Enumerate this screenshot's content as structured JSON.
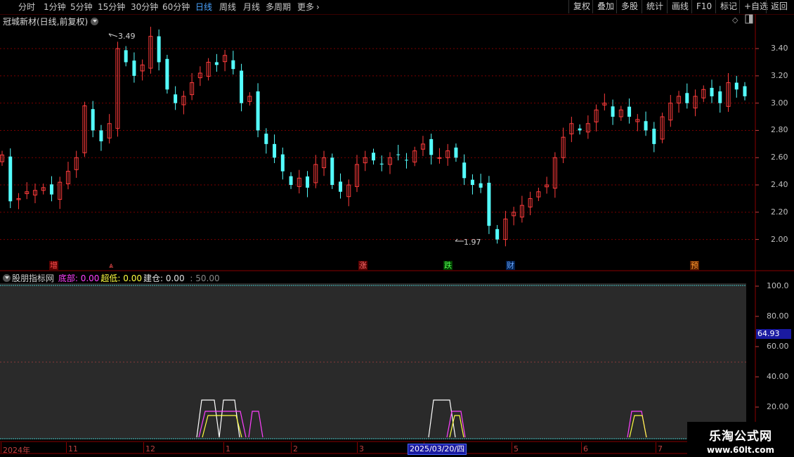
{
  "toolbar": {
    "periods": [
      "分时",
      "1分钟",
      "5分钟",
      "15分钟",
      "30分钟",
      "60分钟",
      "日线",
      "周线",
      "月线",
      "多周期",
      "更多"
    ],
    "active": "日线",
    "right_buttons": [
      "复权",
      "叠加",
      "多股",
      "统计",
      "画线",
      "F10",
      "标记",
      "+自选",
      "返回"
    ]
  },
  "stock": {
    "title": "冠城新材(日线,前复权)"
  },
  "main_axis": {
    "labels": [
      "3.40",
      "3.20",
      "3.00",
      "2.80",
      "2.60",
      "2.40",
      "2.20",
      "2.00"
    ]
  },
  "annotations": {
    "high": "3.49",
    "low": "1.97"
  },
  "events": [
    {
      "label": "增",
      "color": "#ff5050",
      "bg": "#5a0000"
    },
    {
      "label": "⩓",
      "color": "#ff5050",
      "bg": ""
    },
    {
      "label": "涨",
      "color": "#ff7070",
      "bg": "#5a0000"
    },
    {
      "label": "跌",
      "color": "#50ff50",
      "bg": "#004000"
    },
    {
      "label": "财",
      "color": "#6aa8ff",
      "bg": "#002050"
    },
    {
      "label": "预",
      "color": "#ff9a30",
      "bg": "#5a2000"
    }
  ],
  "indicator": {
    "name": "股朋指标网",
    "fields": [
      {
        "label": "底部:",
        "value": "0.00",
        "color": "#ff40ff"
      },
      {
        "label": "超低:",
        "value": "0.00",
        "color": "#ffff40"
      },
      {
        "label": "建仓:",
        "value": "0.00",
        "color": "#e0e0e0"
      }
    ],
    "extra": ": 50.00",
    "axis": [
      "100.0",
      "80.00",
      "60.00",
      "40.00",
      "20.00"
    ],
    "cursor_value": "64.93"
  },
  "xaxis": {
    "labels": [
      "2024年",
      "11",
      "12",
      "1",
      "2",
      "3",
      "4",
      "5",
      "6",
      "7"
    ],
    "cursor_date": "2025/03/20/四"
  },
  "watermark": {
    "line1": "乐淘公式网",
    "line2": "www.60lt.com"
  },
  "colors": {
    "up": "#ff3c3c",
    "down": "#54ffff",
    "grid": "#7a0000",
    "ind_bg": "#2a2a2a"
  },
  "chart_data": {
    "type": "candlestick",
    "ylim": [
      1.9,
      3.55
    ],
    "closes": [
      2.62,
      2.28,
      2.3,
      2.35,
      2.36,
      2.38,
      2.33,
      2.42,
      2.5,
      2.6,
      2.98,
      2.8,
      2.72,
      2.85,
      3.4,
      3.3,
      3.2,
      3.28,
      3.49,
      3.3,
      3.1,
      3.0,
      3.05,
      3.15,
      3.22,
      3.3,
      3.28,
      3.35,
      3.25,
      3.0,
      3.05,
      2.8,
      2.7,
      2.6,
      2.5,
      2.4,
      2.45,
      2.38,
      2.55,
      2.6,
      2.4,
      2.35,
      2.4,
      2.55,
      2.6,
      2.58,
      2.55,
      2.6,
      2.62,
      2.58,
      2.65,
      2.7,
      2.62,
      2.6,
      2.65,
      2.6,
      2.45,
      2.4,
      2.38,
      2.1,
      2.0,
      2.15,
      2.2,
      2.25,
      2.3,
      2.35,
      2.4,
      2.6,
      2.75,
      2.85,
      2.8,
      2.85,
      2.95,
      3.0,
      2.9,
      2.95,
      2.9,
      2.88,
      2.8,
      2.7,
      2.9,
      3.0,
      3.05,
      3.0,
      3.05,
      3.1,
      3.05,
      3.0,
      3.15,
      3.1,
      3.05
    ]
  }
}
